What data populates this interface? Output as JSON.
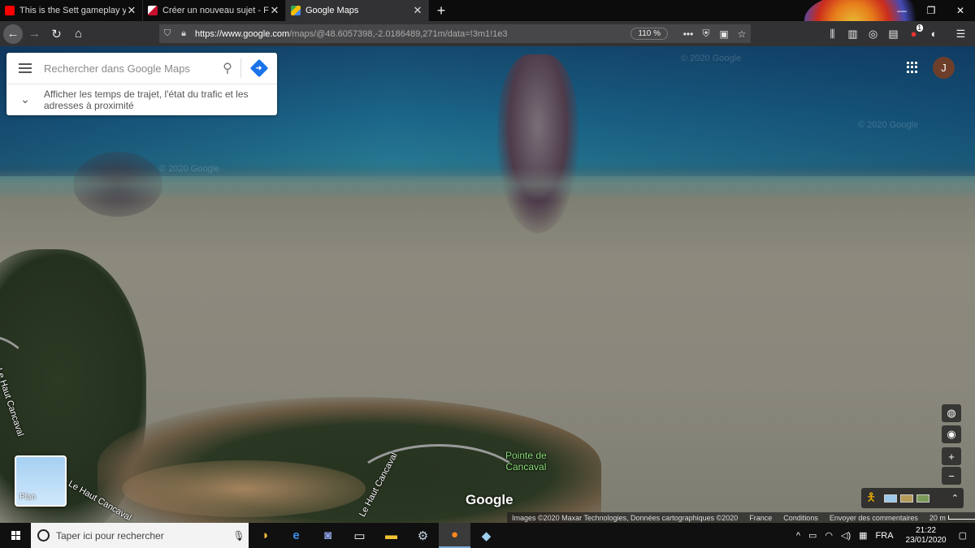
{
  "tabs": [
    {
      "title": "This is the Sett gameplay you w",
      "favicon_color": "#ff0000",
      "active": false
    },
    {
      "title": "Créer un nouveau sujet - Forum",
      "favicon_color": "#c8102e",
      "active": false
    },
    {
      "title": "Google Maps",
      "favicon_color": "#34a853",
      "active": true
    }
  ],
  "nav": {
    "url_host": "https://www.google.com",
    "url_path": "/maps/@48.6057398,-2.0186489,271m/data=!3m1!1e3",
    "zoom": "110 %"
  },
  "toolbar_badge": "1",
  "search": {
    "placeholder": "Rechercher dans Google Maps",
    "info_text": "Afficher les temps de trajet, l'état du trafic et les adresses à proximité"
  },
  "map": {
    "labels": {
      "road_1": "Le Haut Cancaval",
      "road_2": "Le Haut Cancaval",
      "road_3": "Le Haut Cancaval",
      "poi_line1": "Pointe de",
      "poi_line2": "Cancaval"
    },
    "watermark": "© 2020 Google",
    "logo": "Google",
    "layer_label": "Plan",
    "user_initial": "J",
    "attribution": {
      "imagery": "Images ©2020 Maxar Technologies, Données cartographiques ©2020",
      "country": "France",
      "terms": "Conditions",
      "feedback": "Envoyer des commentaires",
      "scale": "20 m"
    }
  },
  "taskbar": {
    "search_placeholder": "Taper ici pour rechercher",
    "lang": "FRA",
    "time": "21:22",
    "date": "23/01/2020"
  },
  "colors": {
    "accent": "#1a73e8",
    "avatar": "#6d3f2b",
    "poi_label": "#8de07a"
  }
}
